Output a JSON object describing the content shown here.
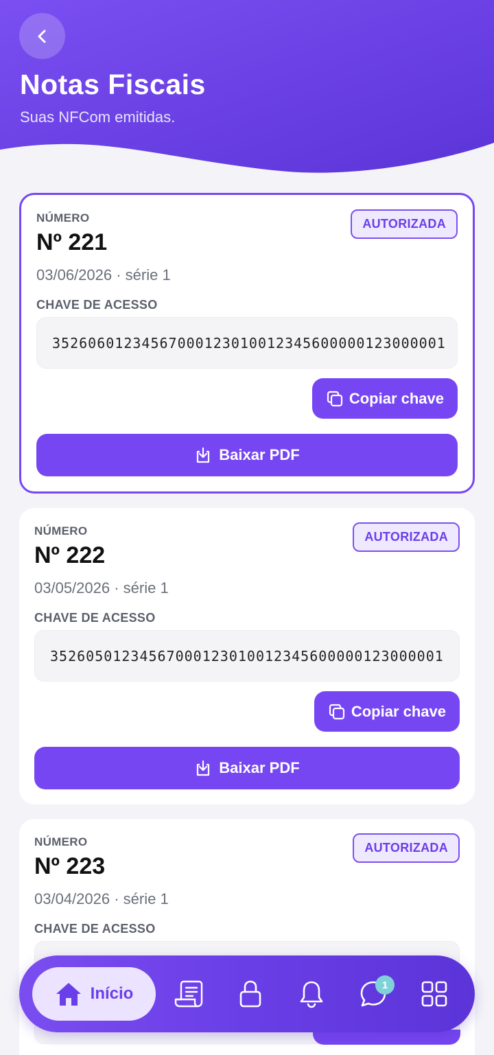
{
  "header": {
    "title": "Notas Fiscais",
    "subtitle": "Suas NFCom emitidas."
  },
  "labels": {
    "number": "NÚMERO",
    "access_key": "CHAVE DE ACESSO",
    "copy": "Copiar chave",
    "download": "Baixar PDF"
  },
  "invoices": [
    {
      "number": "Nº 221",
      "meta": "03/06/2026 · série 1",
      "status": "AUTORIZADA",
      "key": "35260601234567000123010012345600000123000001"
    },
    {
      "number": "Nº 222",
      "meta": "03/05/2026 · série 1",
      "status": "AUTORIZADA",
      "key": "35260501234567000123010012345600000123000001"
    },
    {
      "number": "Nº 223",
      "meta": "03/04/2026 · série 1",
      "status": "AUTORIZADA",
      "key": ""
    }
  ],
  "nav": {
    "home_label": "Início",
    "chat_badge": "1",
    "items": [
      "home-icon",
      "receipt-icon",
      "lock-icon",
      "bell-icon",
      "chat-icon",
      "grid-icon"
    ]
  },
  "colors": {
    "accent": "#7646f2",
    "header_start": "#7b4ff2",
    "header_end": "#5b34d8",
    "badge_bg": "#efe9ff",
    "chat_badge": "#7fd3d8"
  }
}
